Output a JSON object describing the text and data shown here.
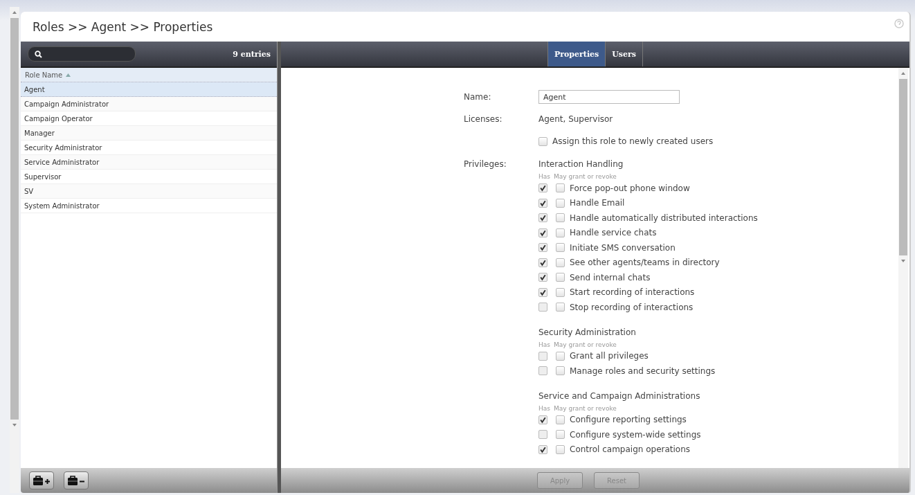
{
  "breadcrumb": "Roles >> Agent >> Properties",
  "search": {
    "entries": "9 entries"
  },
  "table": {
    "column": "Role Name",
    "sort_ascending": true,
    "rows": [
      {
        "name": "Agent",
        "selected": true
      },
      {
        "name": "Campaign Administrator",
        "selected": false
      },
      {
        "name": "Campaign Operator",
        "selected": false
      },
      {
        "name": "Manager",
        "selected": false
      },
      {
        "name": "Security Administrator",
        "selected": false
      },
      {
        "name": "Service Administrator",
        "selected": false
      },
      {
        "name": "Supervisor",
        "selected": false
      },
      {
        "name": "SV",
        "selected": false
      },
      {
        "name": "System Administrator",
        "selected": false
      }
    ]
  },
  "tabs": [
    {
      "label": "Properties",
      "selected": true
    },
    {
      "label": "Users",
      "selected": false
    }
  ],
  "form": {
    "name_label": "Name:",
    "name_value": "Agent",
    "licenses_label": "Licenses:",
    "licenses_value": "Agent, Supervisor",
    "assign": {
      "label": "Assign this role to newly created users",
      "checked": false
    },
    "privileges_label": "Privileges:",
    "groups": [
      {
        "title": "Interaction Handling",
        "col_has": "Has",
        "col_grant": "May grant or revoke",
        "items": [
          {
            "label": "Force pop-out phone window",
            "has": true,
            "grant": false
          },
          {
            "label": "Handle Email",
            "has": true,
            "grant": false
          },
          {
            "label": "Handle automatically distributed interactions",
            "has": true,
            "grant": false
          },
          {
            "label": "Handle service chats",
            "has": true,
            "grant": false
          },
          {
            "label": "Initiate SMS conversation",
            "has": true,
            "grant": false
          },
          {
            "label": "See other agents/teams in directory",
            "has": true,
            "grant": false
          },
          {
            "label": "Send internal chats",
            "has": true,
            "grant": false
          },
          {
            "label": "Start recording of interactions",
            "has": true,
            "grant": false
          },
          {
            "label": "Stop recording of interactions",
            "has": false,
            "grant": false
          }
        ]
      },
      {
        "title": "Security Administration",
        "col_has": "Has",
        "col_grant": "May grant or revoke",
        "items": [
          {
            "label": "Grant all privileges",
            "has": false,
            "grant": false
          },
          {
            "label": "Manage roles and security settings",
            "has": false,
            "grant": false
          }
        ]
      },
      {
        "title": "Service and Campaign Administrations",
        "col_has": "Has",
        "col_grant": "May grant or revoke",
        "items": [
          {
            "label": "Configure reporting settings",
            "has": true,
            "grant": false
          },
          {
            "label": "Configure system-wide settings",
            "has": false,
            "grant": false
          },
          {
            "label": "Control campaign operations",
            "has": true,
            "grant": false
          }
        ]
      }
    ]
  },
  "footer_buttons": [
    {
      "label": "Apply",
      "disabled": true
    },
    {
      "label": "Reset",
      "disabled": true
    }
  ]
}
